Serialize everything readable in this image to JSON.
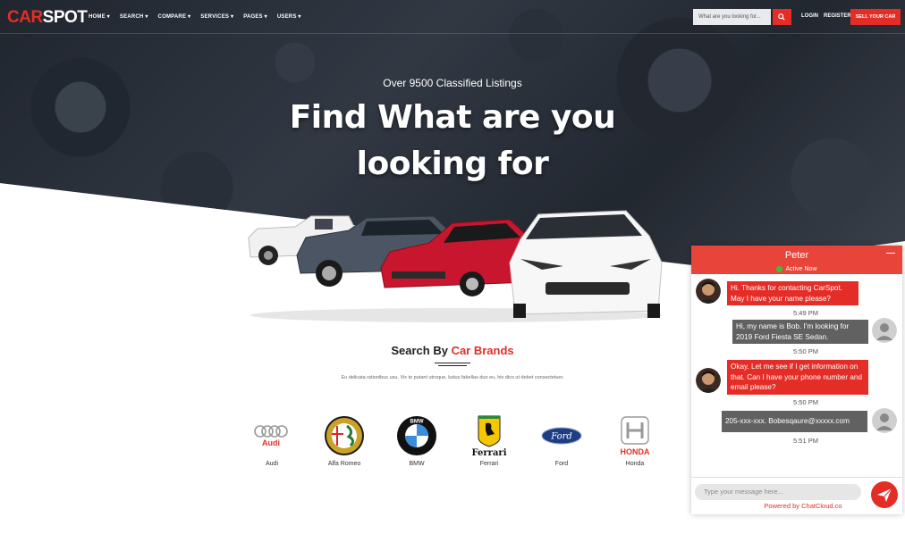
{
  "nav": {
    "logo_a": "CAR",
    "logo_b": "SPOT",
    "menu": [
      "HOME",
      "SEARCH",
      "COMPARE",
      "SERVICES",
      "PAGES",
      "USERS"
    ],
    "search_placeholder": "What are you looking for...",
    "login": "LOGIN",
    "register": "REGISTER",
    "sell": "SELL YOUR CAR"
  },
  "hero": {
    "subtitle": "Over 9500 Classified Listings",
    "title": "Find What are you looking for"
  },
  "brands": {
    "title_a": "Search By ",
    "title_b": "Car Brands",
    "description": "Eu delicata rationibus usu. Vix te putant utroque, ludus fabellas duo eu, his dico ut debet consectetuer.",
    "items": [
      {
        "label": "Audi",
        "logo_text": "Audi"
      },
      {
        "label": "Alfa Romeo"
      },
      {
        "label": "BMW",
        "logo_text": "BMW"
      },
      {
        "label": "Ferrari",
        "logo_text": "Ferrari"
      },
      {
        "label": "Ford",
        "logo_text": "Ford"
      },
      {
        "label": "Honda",
        "logo_text": "HONDA"
      }
    ]
  },
  "chat": {
    "agent_name": "Peter",
    "status": "Active Now",
    "messages": [
      {
        "from": "agent",
        "text": "Hi. Thanks for contacting CarSpot. May I have your name please?",
        "time": "5:49 PM"
      },
      {
        "from": "user",
        "text": "Hi, my name is Bob. I'm looking for 2019 Ford Fiesta SE Sedan.",
        "time": "5:50 PM"
      },
      {
        "from": "agent",
        "text": "Okay. Let me see if I get information on that. Can I have your phone number and email please?",
        "time": "5:50 PM"
      },
      {
        "from": "user",
        "text": "205-xxx-xxx. Bobesqaure@xxxxx.com",
        "time": "5:51 PM"
      }
    ],
    "input_placeholder": "Type your message here...",
    "powered_by": "Powered by ChatCloud.co"
  },
  "colors": {
    "accent": "#e52d27",
    "chat_header": "#e8443a",
    "user_bubble": "#616161",
    "online": "#3cc13b"
  }
}
